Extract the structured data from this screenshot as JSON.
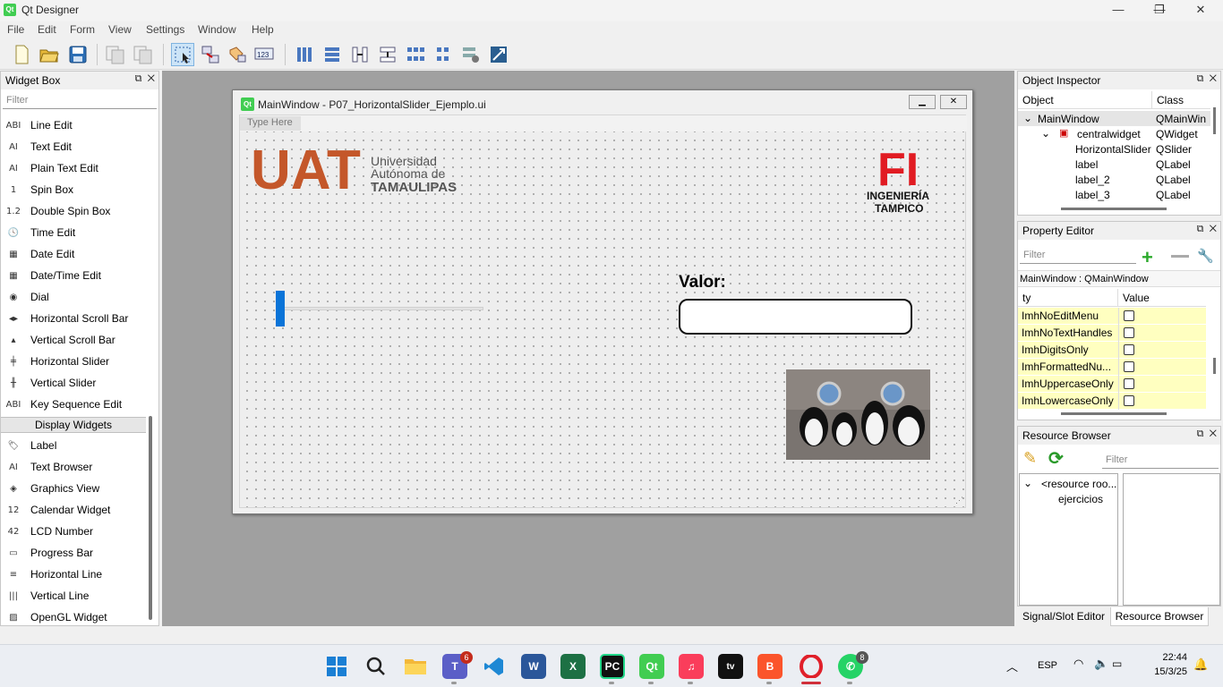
{
  "app": {
    "title": "Qt Designer",
    "icon_text": "Qt"
  },
  "window_controls": {
    "minimize": "—",
    "restore": "❐",
    "close": "✕"
  },
  "menu": [
    "File",
    "Edit",
    "Form",
    "View",
    "Settings",
    "Window",
    "Help"
  ],
  "toolbar": {
    "icons": [
      "new-file-icon",
      "open-folder-icon",
      "save-icon",
      "copy-icon",
      "paste-icon",
      "edit-widgets-icon",
      "edit-signals-slots-icon",
      "edit-buddies-icon",
      "edit-tab-order-icon",
      "layout-horizontal-icon",
      "layout-vertical-icon",
      "layout-splitter-horizontal-icon",
      "layout-splitter-vertical-icon",
      "layout-grid-icon",
      "layout-form-icon",
      "break-layout-icon",
      "adjust-size-icon"
    ]
  },
  "widget_box": {
    "title": "Widget Box",
    "filter_placeholder": "Filter",
    "input_items": [
      {
        "label": "Line Edit",
        "icon": "ABI"
      },
      {
        "label": "Text Edit",
        "icon": "AI"
      },
      {
        "label": "Plain Text Edit",
        "icon": "AI"
      },
      {
        "label": "Spin Box",
        "icon": "1"
      },
      {
        "label": "Double Spin Box",
        "icon": "1.2"
      },
      {
        "label": "Time Edit",
        "icon": "🕓"
      },
      {
        "label": "Date Edit",
        "icon": "▦"
      },
      {
        "label": "Date/Time Edit",
        "icon": "▦"
      },
      {
        "label": "Dial",
        "icon": "◉"
      },
      {
        "label": "Horizontal Scroll Bar",
        "icon": "◂▸"
      },
      {
        "label": "Vertical Scroll Bar",
        "icon": "▴"
      },
      {
        "label": "Horizontal Slider",
        "icon": "╪"
      },
      {
        "label": "Vertical Slider",
        "icon": "╫"
      },
      {
        "label": "Key Sequence Edit",
        "icon": "ABI"
      }
    ],
    "category": "Display Widgets",
    "display_items": [
      {
        "label": "Label",
        "icon": "🏷"
      },
      {
        "label": "Text Browser",
        "icon": "AI"
      },
      {
        "label": "Graphics View",
        "icon": "◈"
      },
      {
        "label": "Calendar Widget",
        "icon": "12"
      },
      {
        "label": "LCD Number",
        "icon": "42"
      },
      {
        "label": "Progress Bar",
        "icon": "▭"
      },
      {
        "label": "Horizontal Line",
        "icon": "≡"
      },
      {
        "label": "Vertical Line",
        "icon": "|||"
      },
      {
        "label": "OpenGL Widget",
        "icon": "▨"
      }
    ]
  },
  "form": {
    "title": "MainWindow - P07_HorizontalSlider_Ejemplo.ui",
    "type_here": "Type Here",
    "uat": {
      "short": "UAT",
      "line1": "Universidad",
      "line2": "Autónoma de",
      "line3": "TAMAULIPAS"
    },
    "fi": {
      "short": "FI",
      "line1": "INGENIERÍA",
      "line2": "TAMPICO"
    },
    "valor_label": "Valor:",
    "valor_value": "",
    "slider_value_fraction": 0
  },
  "object_inspector": {
    "title": "Object Inspector",
    "col_object": "Object",
    "col_class": "Class",
    "rows": [
      {
        "object": "MainWindow",
        "class": "QMainWin"
      },
      {
        "object": "centralwidget",
        "class": "QWidget"
      },
      {
        "object": "HorizontalSlider",
        "class": "QSlider"
      },
      {
        "object": "label",
        "class": "QLabel"
      },
      {
        "object": "label_2",
        "class": "QLabel"
      },
      {
        "object": "label_3",
        "class": "QLabel"
      }
    ]
  },
  "property_editor": {
    "title": "Property Editor",
    "filter_placeholder": "Filter",
    "context": "MainWindow : QMainWindow",
    "col_property": "ty",
    "col_value": "Value",
    "rows": [
      "ImhNoEditMenu",
      "ImhNoTextHandles",
      "ImhDigitsOnly",
      "ImhFormattedNu...",
      "ImhUppercaseOnly",
      "ImhLowercaseOnly"
    ]
  },
  "resource_browser": {
    "title": "Resource Browser",
    "filter_placeholder": "Filter",
    "root": "<resource roo...",
    "child": "ejercicios"
  },
  "bottom_tabs": [
    "Signal/Slot Editor",
    "Resource Browser"
  ],
  "taskbar": {
    "teams_badge": "6",
    "whatsapp_badge": "8",
    "language": "ESP",
    "time": "22:44",
    "date": "15/3/25"
  },
  "colors": {
    "slider_handle": "#0a74d8",
    "uat_orange": "#c4572a",
    "fi_red": "#e11b22",
    "property_row": "#ffffc0"
  }
}
